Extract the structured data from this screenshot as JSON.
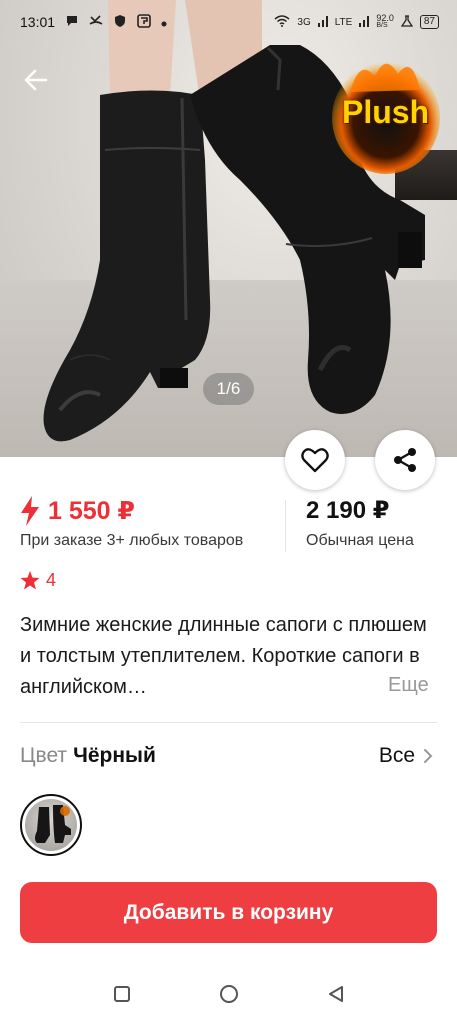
{
  "status_bar": {
    "time": "13:01",
    "network_1": "3G",
    "network_2": "LTE",
    "speed": "92.0",
    "speed_unit": "B/S",
    "battery": "87"
  },
  "gallery": {
    "badge_text": "Plush",
    "counter": "1/6"
  },
  "price": {
    "sale_price": "1 550 ₽",
    "sale_note": "При заказе 3+ любых товаров",
    "regular_price": "2 190 ₽",
    "regular_note": "Обычная цена"
  },
  "rating": {
    "value": "4"
  },
  "product": {
    "title": "Зимние женские длинные сапоги с плюшем и толстым утеплителем. Короткие сапоги в английском…",
    "more_label": "Еще"
  },
  "variant": {
    "label": "Цвет",
    "value": "Чёрный",
    "all_label": "Все"
  },
  "actions": {
    "add_to_cart": "Добавить в корзину"
  },
  "colors": {
    "accent": "#ef3e42",
    "price_red": "#ee2f35",
    "muted_text": "#999999"
  }
}
